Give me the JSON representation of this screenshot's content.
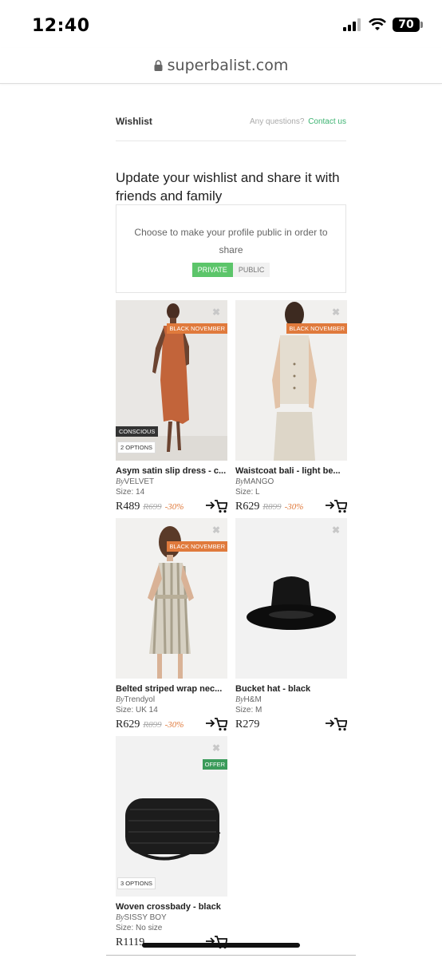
{
  "status_bar": {
    "time": "12:40",
    "battery": "70"
  },
  "browser": {
    "url": "superbalist.com"
  },
  "header": {
    "title": "Wishlist",
    "questions": "Any questions?",
    "contact": "Contact us"
  },
  "headline": "Update your wishlist and share it with friends and family",
  "public_box": {
    "text": "Choose to make your profile public in order to share",
    "private_label": "PRIVATE",
    "public_label": "PUBLIC"
  },
  "products": [
    {
      "name": "Asym satin slip dress - c...",
      "by": "By",
      "brand": "VELVET",
      "size": "Size: 14",
      "price": "R489",
      "old_price": "R699",
      "discount": "-30%",
      "badge": "BLACK NOVEMBER",
      "tag": "CONSCIOUS",
      "options": "2 OPTIONS"
    },
    {
      "name": "Waistcoat bali - light be...",
      "by": "By",
      "brand": "MANGO",
      "size": "Size: L",
      "price": "R629",
      "old_price": "R899",
      "discount": "-30%",
      "badge": "BLACK NOVEMBER"
    },
    {
      "name": "Belted striped wrap nec...",
      "by": "By",
      "brand": "Trendyol",
      "size": "Size: UK 14",
      "price": "R629",
      "old_price": "R899",
      "discount": "-30%",
      "badge": "BLACK NOVEMBER"
    },
    {
      "name": "Bucket hat - black",
      "by": "By",
      "brand": "H&M",
      "size": "Size: M",
      "price": "R279"
    },
    {
      "name": "Woven crossbady - black",
      "by": "By",
      "brand": "SISSY BOY",
      "size": "Size: No size",
      "price": "R1119",
      "badge": "OFFER",
      "options": "3 OPTIONS"
    }
  ],
  "remove_glyph": "✖",
  "colors": {
    "accent_green": "#5cc56a",
    "contact_green": "#3cb371",
    "badge_orange": "#e07a3c",
    "offer_green": "#3a9b5a"
  }
}
